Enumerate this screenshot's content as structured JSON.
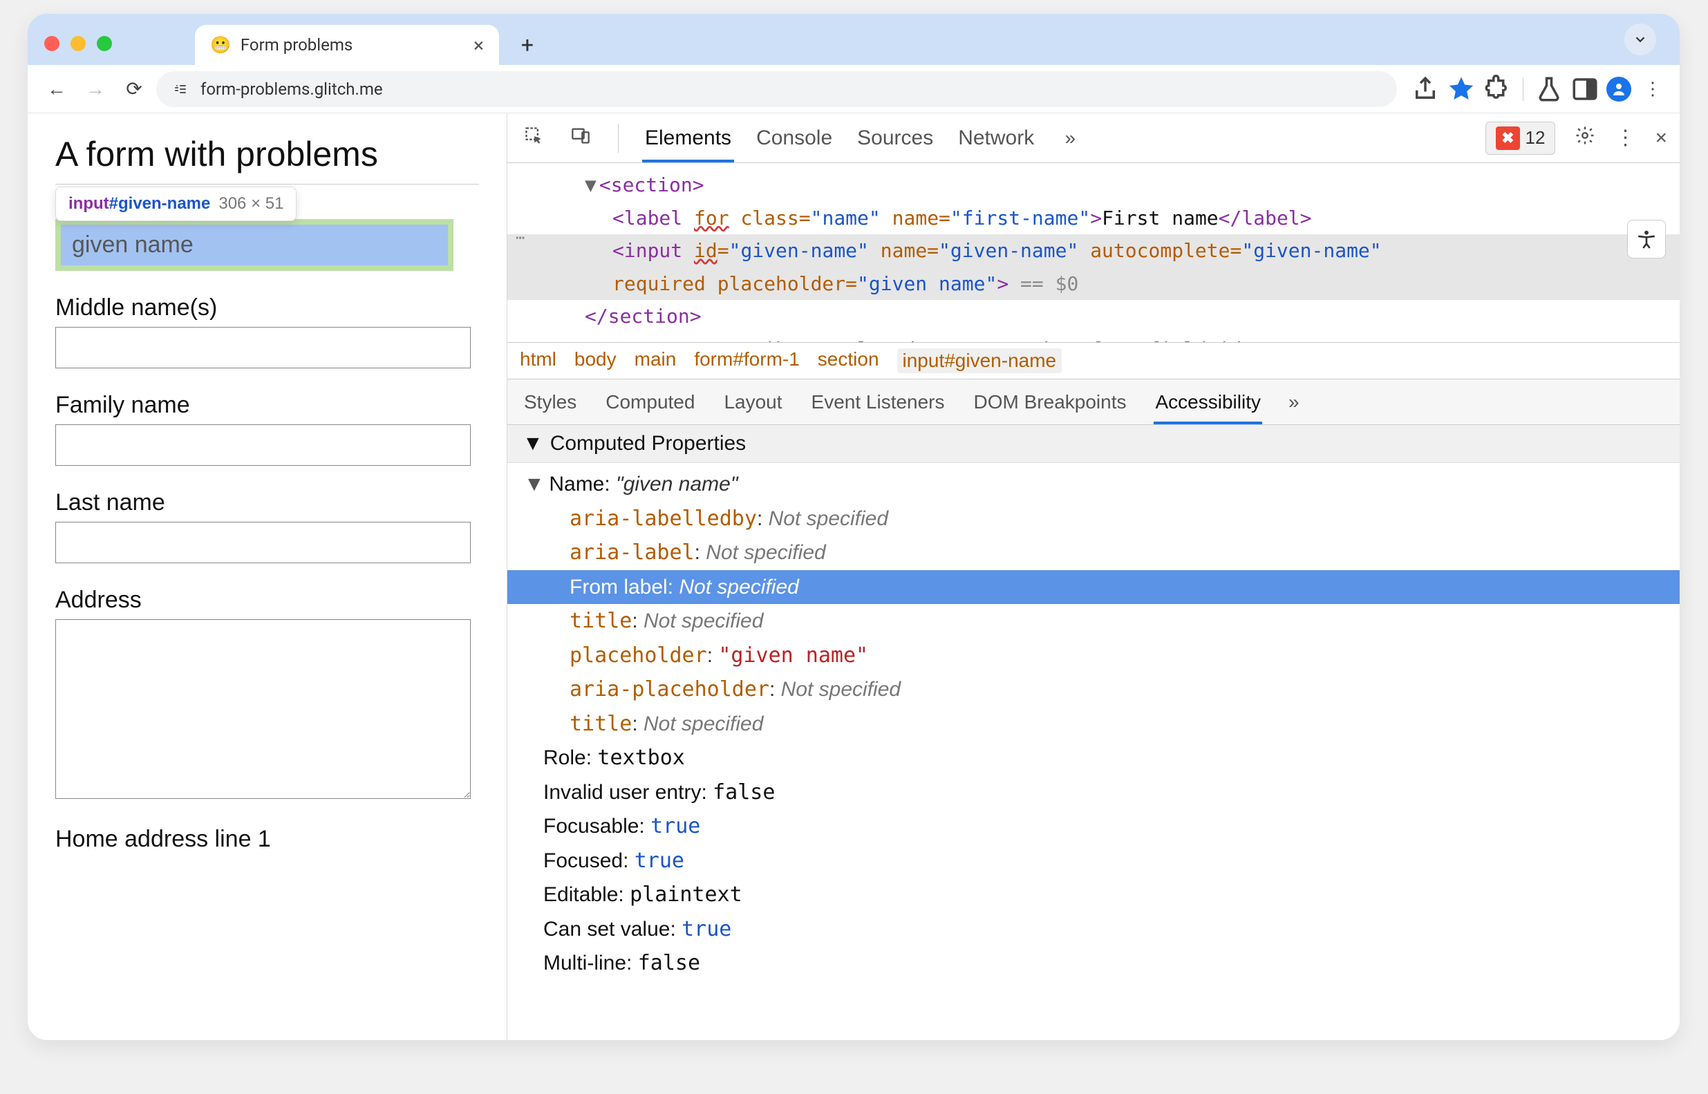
{
  "tab": {
    "favicon": "😬",
    "title": "Form problems"
  },
  "toolbar": {
    "url": "form-problems.glitch.me",
    "site_icon": "⬚"
  },
  "page": {
    "heading": "A form with problems",
    "tooltip_tag": "input",
    "tooltip_id": "#given-name",
    "tooltip_dims": "306 × 51",
    "given_name_placeholder": "given name",
    "labels": {
      "middle": "Middle name(s)",
      "family": "Family name",
      "last": "Last name",
      "address": "Address",
      "home_line1": "Home address line 1"
    }
  },
  "devtools": {
    "tabs": [
      "Elements",
      "Console",
      "Sources",
      "Network"
    ],
    "error_count": "12",
    "breadcrumb": [
      "html",
      "body",
      "main",
      "form#form-1",
      "section",
      "input#given-name"
    ],
    "subtabs": [
      "Styles",
      "Computed",
      "Layout",
      "Event Listeners",
      "DOM Breakpoints",
      "Accessibility"
    ],
    "section_title": "Computed Properties",
    "dom": {
      "label_line_text": "First name",
      "for_attr": "for",
      "label_class": "name",
      "label_name": "first-name",
      "input_id": "given-name",
      "input_name": "given-name",
      "input_autocomplete": "given-name",
      "input_required": "required",
      "input_placeholder": "given name",
      "eq": "== $0",
      "comment_fragment": "For attribute value doesn't match a form field id"
    },
    "a11y": {
      "name_key": "Name:",
      "name_value": "given name",
      "aria_labelledby": "aria-labelledby",
      "aria_label": "aria-label",
      "from_label": "From label:",
      "title": "title",
      "placeholder_key": "placeholder",
      "placeholder_val": "\"given name\"",
      "aria_placeholder": "aria-placeholder",
      "not_specified": "Not specified",
      "role_key": "Role:",
      "role_val": "textbox",
      "invalid_key": "Invalid user entry:",
      "invalid_val": "false",
      "focusable_key": "Focusable:",
      "focusable_val": "true",
      "focused_key": "Focused:",
      "focused_val": "true",
      "editable_key": "Editable:",
      "editable_val": "plaintext",
      "cansetvalue_key": "Can set value:",
      "cansetvalue_val": "true",
      "multiline_key": "Multi-line:",
      "multiline_val": "false"
    }
  }
}
